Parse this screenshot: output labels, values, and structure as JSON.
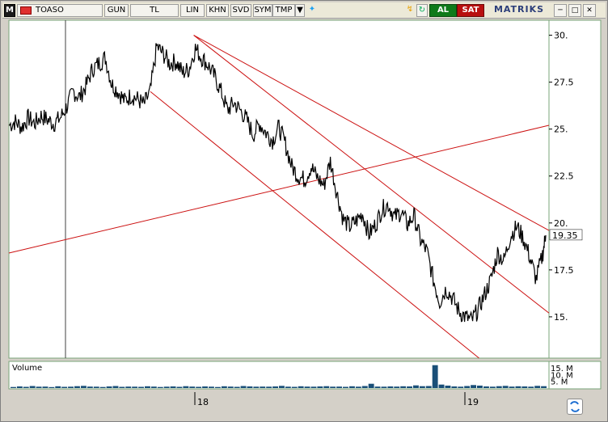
{
  "toolbar": {
    "m_label": "M",
    "symbol": "TOASO",
    "period": "GUN",
    "currency": "TL",
    "scale": "LIN",
    "khn": "KHN",
    "svd": "SVD",
    "sym": "SYM",
    "tmp": "TMP",
    "buy": "AL",
    "sell": "SAT",
    "logo": "MATRIKS",
    "icons": [
      "dropdown-arrow-icon",
      "twitter-bird-icon",
      "lightning-icon",
      "refresh-icon",
      "minimize-icon",
      "maximize-icon",
      "close-icon"
    ]
  },
  "chart_data": {
    "type": "line",
    "symbol": "TOASO",
    "ylim": [
      12.8,
      30.8
    ],
    "y_ticks": [
      30.0,
      27.5,
      25.0,
      22.5,
      20.0,
      17.5,
      15.0
    ],
    "y_tick_labels": [
      "30.",
      "27.5",
      "25.",
      "22.5",
      "20.",
      "17.5",
      "15."
    ],
    "last_price": 19.35,
    "last_price_label": "19.35",
    "x_tick_labels": [
      "18",
      "19"
    ],
    "colors": {
      "price": "#000000",
      "trendline": "#cc1111",
      "volume": "#1a4f78",
      "last_price_box": "#ffffff"
    },
    "price_series": {
      "points": [
        [
          0,
          25.2
        ],
        [
          8,
          25.4
        ],
        [
          16,
          25.1
        ],
        [
          24,
          25.6
        ],
        [
          32,
          25.3
        ],
        [
          40,
          25.7
        ],
        [
          48,
          25.5
        ],
        [
          56,
          25.3
        ],
        [
          64,
          25.6
        ],
        [
          72,
          26.2
        ],
        [
          80,
          27.0
        ],
        [
          88,
          26.7
        ],
        [
          96,
          27.3
        ],
        [
          104,
          28.2
        ],
        [
          112,
          28.5
        ],
        [
          120,
          28.8
        ],
        [
          128,
          27.4
        ],
        [
          136,
          27.0
        ],
        [
          144,
          26.5
        ],
        [
          152,
          26.8
        ],
        [
          160,
          26.6
        ],
        [
          168,
          26.3
        ],
        [
          176,
          27.0
        ],
        [
          184,
          29.4
        ],
        [
          192,
          29.0
        ],
        [
          200,
          28.5
        ],
        [
          208,
          28.6
        ],
        [
          216,
          28.0
        ],
        [
          224,
          28.2
        ],
        [
          232,
          29.3
        ],
        [
          240,
          28.8
        ],
        [
          248,
          28.4
        ],
        [
          256,
          27.8
        ],
        [
          264,
          27.0
        ],
        [
          272,
          26.0
        ],
        [
          280,
          26.4
        ],
        [
          288,
          26.0
        ],
        [
          296,
          25.5
        ],
        [
          304,
          24.7
        ],
        [
          312,
          25.3
        ],
        [
          320,
          24.8
        ],
        [
          328,
          24.4
        ],
        [
          336,
          25.1
        ],
        [
          344,
          24.2
        ],
        [
          352,
          23.0
        ],
        [
          360,
          22.5
        ],
        [
          368,
          22.3
        ],
        [
          376,
          23.0
        ],
        [
          384,
          22.4
        ],
        [
          392,
          22.0
        ],
        [
          400,
          23.3
        ],
        [
          408,
          21.6
        ],
        [
          416,
          20.2
        ],
        [
          424,
          19.8
        ],
        [
          432,
          20.1
        ],
        [
          440,
          20.5
        ],
        [
          448,
          19.4
        ],
        [
          456,
          19.9
        ],
        [
          464,
          20.7
        ],
        [
          472,
          21.0
        ],
        [
          480,
          20.3
        ],
        [
          488,
          20.6
        ],
        [
          496,
          19.9
        ],
        [
          504,
          20.4
        ],
        [
          512,
          19.1
        ],
        [
          520,
          18.5
        ],
        [
          528,
          17.0
        ],
        [
          536,
          15.8
        ],
        [
          544,
          16.5
        ],
        [
          552,
          16.0
        ],
        [
          560,
          15.3
        ],
        [
          568,
          15.0
        ],
        [
          576,
          14.8
        ],
        [
          584,
          15.4
        ],
        [
          592,
          16.2
        ],
        [
          600,
          17.0
        ],
        [
          608,
          18.4
        ],
        [
          616,
          18.0
        ],
        [
          624,
          19.3
        ],
        [
          632,
          19.8
        ],
        [
          640,
          19.2
        ],
        [
          648,
          18.2
        ],
        [
          656,
          17.0
        ],
        [
          664,
          18.3
        ],
        [
          668,
          19.35
        ]
      ]
    },
    "trendlines": [
      {
        "from": [
          0,
          18.4
        ],
        "to": [
          672,
          25.2
        ]
      },
      {
        "from": [
          230,
          30.0
        ],
        "to": [
          672,
          19.6
        ]
      },
      {
        "from": [
          230,
          30.0
        ],
        "to": [
          672,
          15.2
        ]
      },
      {
        "from": [
          176,
          27.0
        ],
        "to": [
          585,
          12.8
        ]
      }
    ],
    "volume": {
      "title": "Volume",
      "y_tick_labels": [
        "15. M",
        "10. M",
        "5. M"
      ],
      "values_m": [
        0.8,
        1.2,
        0.9,
        1.5,
        1.0,
        1.1,
        0.7,
        1.3,
        0.9,
        1.0,
        1.4,
        1.6,
        1.1,
        1.0,
        0.8,
        1.2,
        1.5,
        0.9,
        1.1,
        1.0,
        0.9,
        1.3,
        1.1,
        0.8,
        1.0,
        1.2,
        0.9,
        1.4,
        1.1,
        0.9,
        1.2,
        1.0,
        0.8,
        1.3,
        1.1,
        0.9,
        1.5,
        1.2,
        1.0,
        1.1,
        1.0,
        1.2,
        1.6,
        1.0,
        0.9,
        1.3,
        1.1,
        1.0,
        1.2,
        1.4,
        1.0,
        1.1,
        0.9,
        1.3,
        1.0,
        1.5,
        3.2,
        1.1,
        1.0,
        1.2,
        1.1,
        1.3,
        1.2,
        2.0,
        1.4,
        1.5,
        17.0,
        2.6,
        1.8,
        1.2,
        1.0,
        1.5,
        2.2,
        1.8,
        1.2,
        1.0,
        1.4,
        1.6,
        1.1,
        1.3,
        1.2,
        1.0,
        1.6,
        1.4
      ]
    }
  }
}
